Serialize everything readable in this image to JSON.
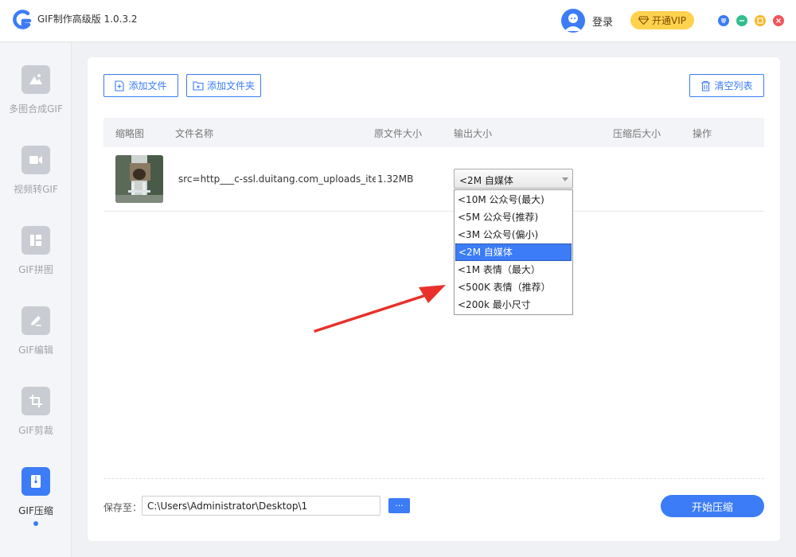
{
  "app": {
    "title": "GIF制作高级版 1.0.3.2",
    "accent_color": "#3c7cf6"
  },
  "header": {
    "login_label": "登录",
    "vip_label": "开通VIP",
    "icons": [
      "user-avatar-icon",
      "diamond-icon",
      "feedback-icon",
      "minimize-icon",
      "maximize-icon",
      "close-icon"
    ]
  },
  "sidebar": {
    "items": [
      {
        "label": "多图合成GIF",
        "icon": "image-mountain-icon",
        "active": false
      },
      {
        "label": "视频转GIF",
        "icon": "video-icon",
        "active": false
      },
      {
        "label": "GIF拼图",
        "icon": "layout-icon",
        "active": false
      },
      {
        "label": "GIF编辑",
        "icon": "pencil-icon",
        "active": false
      },
      {
        "label": "GIF剪裁",
        "icon": "crop-icon",
        "active": false
      },
      {
        "label": "GIF压缩",
        "icon": "zip-icon",
        "active": true
      }
    ]
  },
  "toolbar": {
    "add_file_label": "添加文件",
    "add_folder_label": "添加文件夹",
    "clear_list_label": "清空列表"
  },
  "table": {
    "headers": [
      "缩略图",
      "文件名称",
      "原文件大小",
      "输出大小",
      "压缩后大小",
      "操作"
    ],
    "rows": [
      {
        "filename": "src=http___c-ssl.duitang.com_uploads_iter",
        "original_size": "1.32MB",
        "output_size": "<2M 自媒体",
        "compressed_size": "",
        "action": ""
      }
    ]
  },
  "output_size_dropdown": {
    "selected": "<2M 自媒体",
    "options": [
      "<10M 公众号(最大)",
      "<5M 公众号(推荐)",
      "<3M 公众号(偏小)",
      "<2M 自媒体",
      "<1M 表情（最大）",
      "<500K 表情（推荐）",
      "<200k 最小尺寸"
    ]
  },
  "footer": {
    "save_to_label": "保存至：",
    "save_path": "C:\\Users\\Administrator\\Desktop\\1",
    "browse_label": "···",
    "start_label": "开始压缩"
  }
}
